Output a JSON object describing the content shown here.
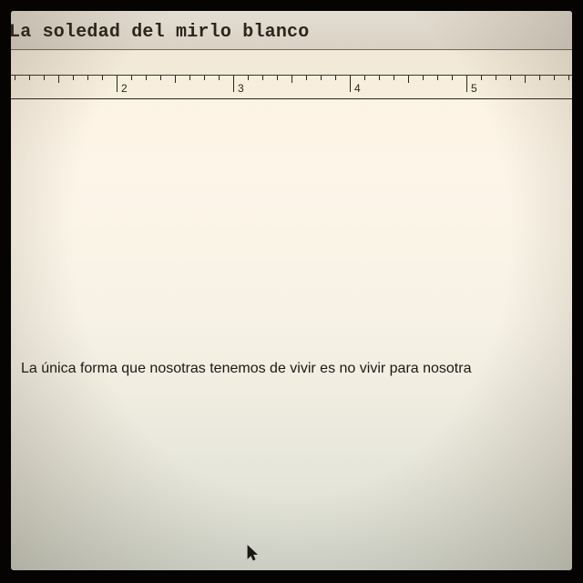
{
  "window": {
    "document_title": "La soledad del mirlo blanco"
  },
  "ruler": {
    "labels": [
      "2",
      "3",
      "4",
      "5"
    ]
  },
  "document": {
    "body_text": "La única forma que nosotras tenemos de vivir es no vivir para nosotra"
  },
  "icons": {
    "pointer": "mouse-pointer-icon"
  }
}
